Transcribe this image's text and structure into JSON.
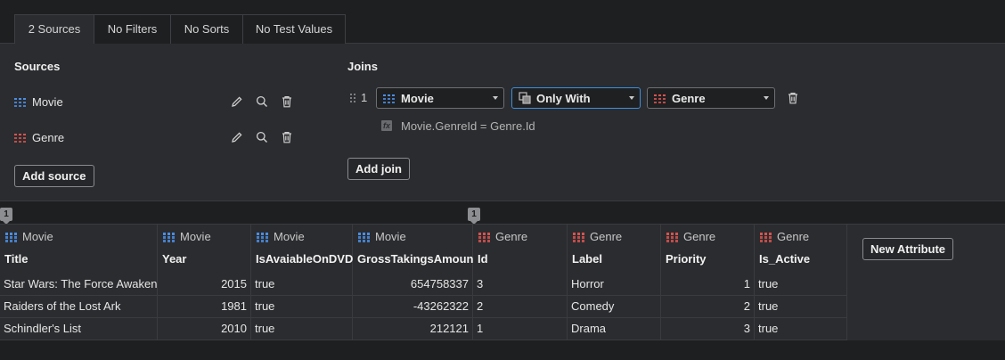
{
  "colors": {
    "movie_icon": "#4a8fe6",
    "genre_icon": "#d9534f",
    "focus": "#3d8fe0"
  },
  "tabs": [
    "2 Sources",
    "No Filters",
    "No Sorts",
    "No Test Values"
  ],
  "sources": {
    "heading": "Sources",
    "items": [
      {
        "name": "Movie",
        "icon": "table-icon-blue"
      },
      {
        "name": "Genre",
        "icon": "table-icon-red"
      }
    ],
    "add_label": "Add source"
  },
  "joins": {
    "heading": "Joins",
    "items": [
      {
        "index": "1",
        "left": "Movie",
        "type": "Only With",
        "right": "Genre",
        "condition": "Movie.GenreId = Genre.Id"
      }
    ],
    "add_label": "Add join"
  },
  "badges": [
    "1",
    "1"
  ],
  "grid": {
    "columns": [
      {
        "source": "Movie",
        "name": "Title"
      },
      {
        "source": "Movie",
        "name": "Year"
      },
      {
        "source": "Movie",
        "name": "IsAvaiableOnDVD"
      },
      {
        "source": "Movie",
        "name": "GrossTakingsAmount"
      },
      {
        "source": "Genre",
        "name": "Id"
      },
      {
        "source": "Genre",
        "name": "Label"
      },
      {
        "source": "Genre",
        "name": "Priority"
      },
      {
        "source": "Genre",
        "name": "Is_Active"
      }
    ],
    "new_attribute_label": "New Attribute",
    "rows": [
      [
        "Star Wars: The Force Awakens",
        "2015",
        "true",
        "654758337",
        "3",
        "Horror",
        "1",
        "true"
      ],
      [
        "Raiders of the Lost Ark",
        "1981",
        "true",
        "-43262322",
        "2",
        "Comedy",
        "2",
        "true"
      ],
      [
        "Schindler's List",
        "2010",
        "true",
        "212121",
        "1",
        "Drama",
        "3",
        "true"
      ]
    ]
  }
}
